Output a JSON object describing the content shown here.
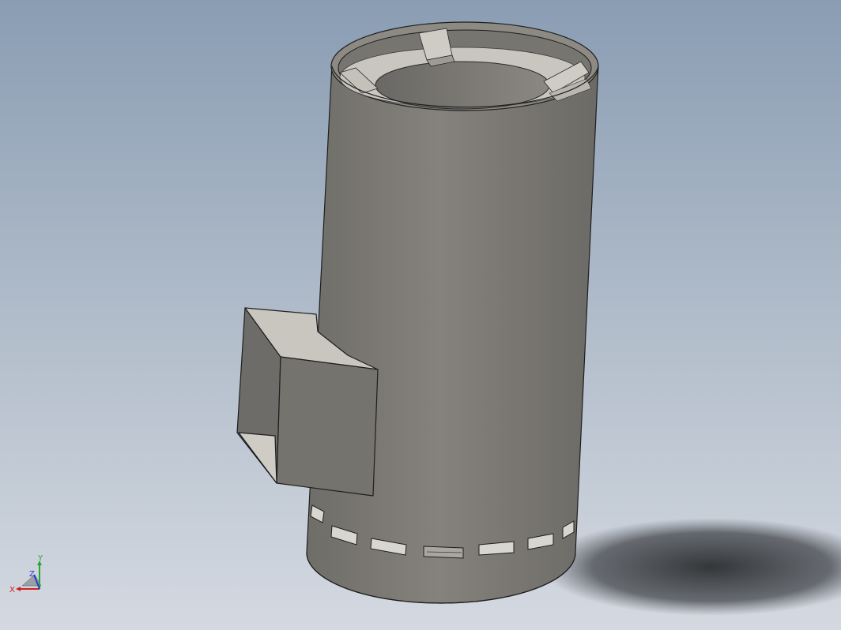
{
  "viewport": {
    "background_top": "#8c9fb4",
    "background_bottom": "#d2d7e0",
    "model_color": "#7c7a75",
    "shadow_color": "#2f3134"
  },
  "triad": {
    "x_label": "X",
    "y_label": "Y",
    "z_label": "Z",
    "x_color": "#d21f1f",
    "y_color": "#26a634",
    "z_color": "#2a3fd0"
  }
}
